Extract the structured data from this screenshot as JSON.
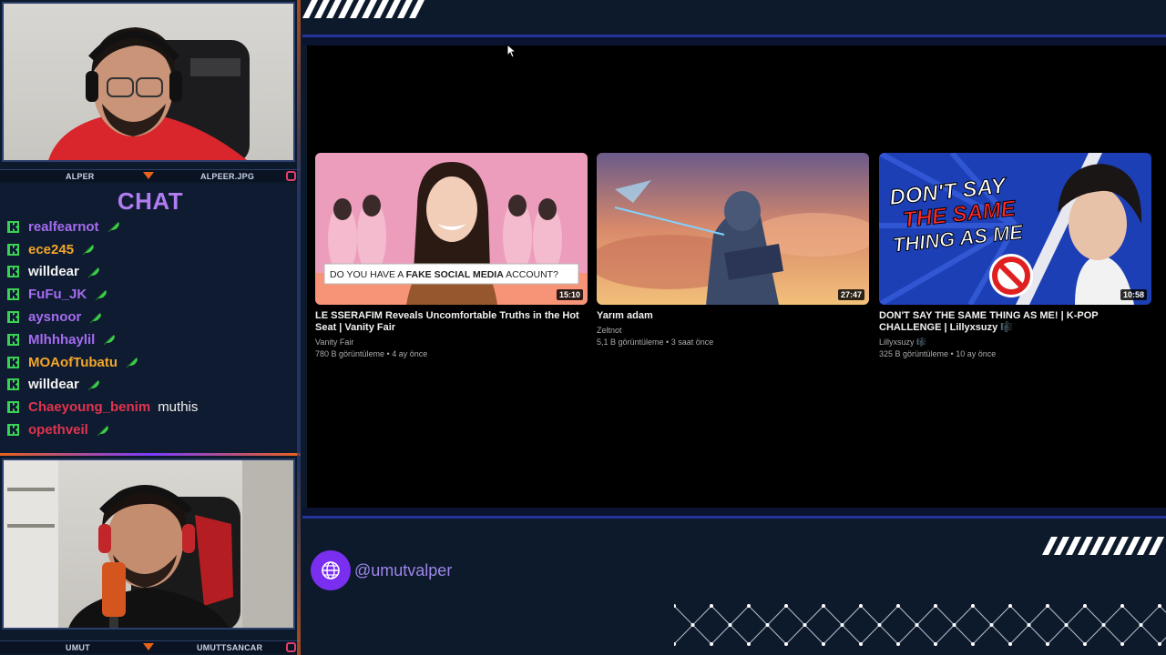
{
  "stream": {
    "top_cam": {
      "left_name": "ALPER",
      "right_name": "ALPEER.JPG"
    },
    "bottom_cam": {
      "left_name": "UMUT",
      "right_name": "UMUTTSANCAR"
    },
    "social_handle": "@umutvalper"
  },
  "chat": {
    "title": "CHAT",
    "messages": [
      {
        "user": "realfearnot",
        "color": "#a56cf0",
        "message": "",
        "emote": "green-feather"
      },
      {
        "user": "ece245",
        "color": "#f4a62a",
        "message": "",
        "emote": "green-feather"
      },
      {
        "user": "willdear",
        "color": "#f2f2f2",
        "message": "",
        "emote": "green-feather"
      },
      {
        "user": "FuFu_JK",
        "color": "#a56cf0",
        "message": "",
        "emote": "green-feather"
      },
      {
        "user": "aysnoor",
        "color": "#a56cf0",
        "message": "",
        "emote": "green-feather"
      },
      {
        "user": "Mlhhhaylil",
        "color": "#a56cf0",
        "message": "",
        "emote": "green-feather"
      },
      {
        "user": "MOAofTubatu",
        "color": "#f4a62a",
        "message": "",
        "emote": "green-feather"
      },
      {
        "user": "willdear",
        "color": "#f2f2f2",
        "message": "",
        "emote": "green-feather"
      },
      {
        "user": "Chaeyoung_benim",
        "color": "#e0344f",
        "message": "muthis",
        "emote": ""
      },
      {
        "user": "opethveil",
        "color": "#e0344f",
        "message": "",
        "emote": "green-feather"
      }
    ]
  },
  "videos": [
    {
      "title": "LE SSERAFIM Reveals Uncomfortable Truths in the Hot Seat | Vanity Fair",
      "channel": "Vanity Fair",
      "meta": "780 B görüntüleme • 4 ay önce",
      "duration": "15:10",
      "thumb_caption_a": "DO YOU HAVE A",
      "thumb_caption_b": "FAKE SOCIAL MEDIA",
      "thumb_caption_c": "ACCOUNT?"
    },
    {
      "title": "Yarım adam",
      "channel": "Zeltnot",
      "meta": "5,1 B görüntüleme • 3 saat önce",
      "duration": "27:47"
    },
    {
      "title": "DON'T SAY THE SAME THING AS ME! | K-POP CHALLENGE | Lillyxsuzy 🎼",
      "channel": "Lillyxsuzy 🎼",
      "meta": "325 B görüntüleme • 10 ay önce",
      "duration": "10:58",
      "thumb_line1": "DON'T SAY",
      "thumb_line2": "THE SAME",
      "thumb_line3": "THING AS ME"
    }
  ],
  "colors": {
    "accent_purple": "#7a2ff0",
    "accent_orange": "#e8621c",
    "frame_blue": "#24349a",
    "badge_green": "#39d353"
  }
}
